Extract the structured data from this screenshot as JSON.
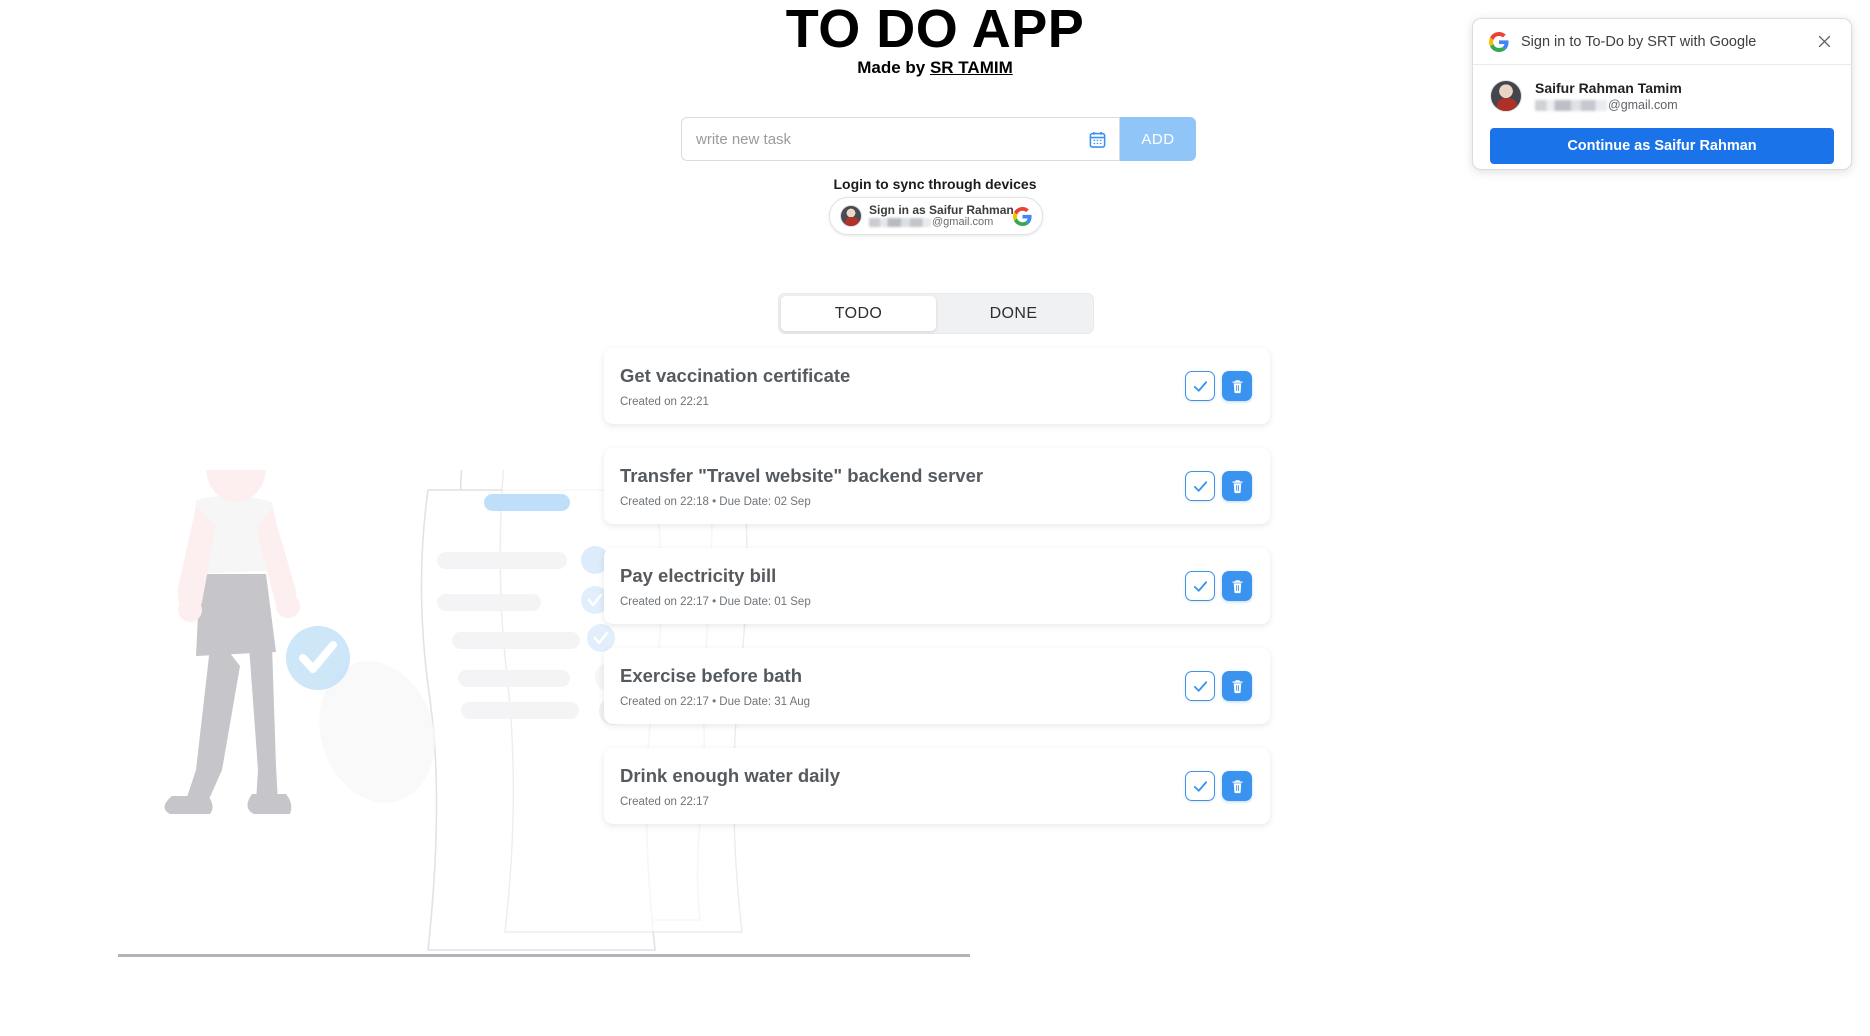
{
  "header": {
    "title": "TO DO APP",
    "made_by_prefix": "Made by ",
    "author": "SR TAMIM"
  },
  "compose": {
    "placeholder": "write new task",
    "value": "",
    "calendar_icon": "calendar-icon",
    "add_label": "ADD"
  },
  "login": {
    "sync_label": "Login to sync through devices",
    "signin_name": "Sign in as Saifur Rahman",
    "email_domain": "@gmail.com",
    "google_icon": "google-g-icon"
  },
  "tabs": [
    {
      "label": "TODO",
      "active": true
    },
    {
      "label": "DONE",
      "active": false
    }
  ],
  "tasks": [
    {
      "title": "Get vaccination certificate",
      "meta": "Created on 22:21"
    },
    {
      "title": "Transfer \"Travel website\" backend server",
      "meta": "Created on 22:18  •  Due Date: 02 Sep"
    },
    {
      "title": "Pay electricity bill",
      "meta": "Created on 22:17  •  Due Date: 01 Sep"
    },
    {
      "title": "Exercise before bath",
      "meta": "Created on 22:17  •  Due Date: 31 Aug"
    },
    {
      "title": "Drink enough water daily",
      "meta": "Created on 22:17"
    }
  ],
  "task_actions": {
    "complete_icon": "check-icon",
    "delete_icon": "trash-icon"
  },
  "onetap": {
    "title": "Sign in to To-Do by SRT with Google",
    "close_icon": "close-icon",
    "user_name": "Saifur Rahman Tamim",
    "email_domain": "@gmail.com",
    "cta_label": "Continue as Saifur Rahman"
  },
  "colors": {
    "accent_blue": "#3b93f0",
    "add_button_blue": "#90c6f7",
    "google_blue": "#1a73e8",
    "task_title_gray": "#555a5e"
  }
}
